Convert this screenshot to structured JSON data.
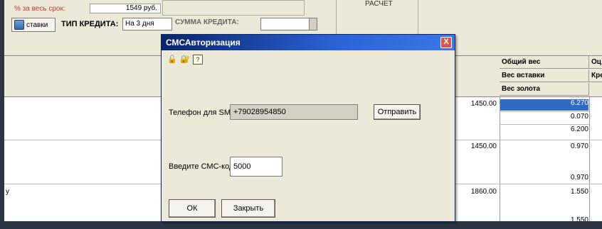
{
  "top": {
    "term_label": "% за весь срок:",
    "term_value": "1549 руб.",
    "right_header_text": "РАСЧЕТ",
    "rates_button": "ставки",
    "credit_type_label": "ТИП КРЕДИТА:",
    "credit_type_value": "На 3 дня",
    "partial_label": "СУММА КРЕДИТА:"
  },
  "grid": {
    "headers": [
      "Общий вес",
      "Вес вставки",
      "Вес золота"
    ],
    "right_partial_headers": [
      "Оц",
      "Кре"
    ],
    "rows": [
      {
        "price": "1450.00",
        "weights": [
          "6.270",
          "0.070",
          "6.200"
        ],
        "left": ""
      },
      {
        "price": "1450.00",
        "weights": [
          "0.970",
          "0.970"
        ],
        "left": ""
      },
      {
        "price": "1860.00",
        "weights": [
          "1.550",
          "1.550"
        ],
        "left": "у"
      }
    ]
  },
  "dialog": {
    "title": "СМСАвторизация",
    "close": "X",
    "tools": [
      "unlock-icon",
      "users-lock-icon",
      "help-icon"
    ],
    "help_glyph": "?",
    "phone_label": "Телефон для SMS",
    "phone_value": "+79028954850",
    "send_button": "Отправить",
    "code_label": "Введите СМС-код:",
    "code_value": "5000",
    "ok_button": "ОК",
    "close_button": "Закрыть"
  }
}
